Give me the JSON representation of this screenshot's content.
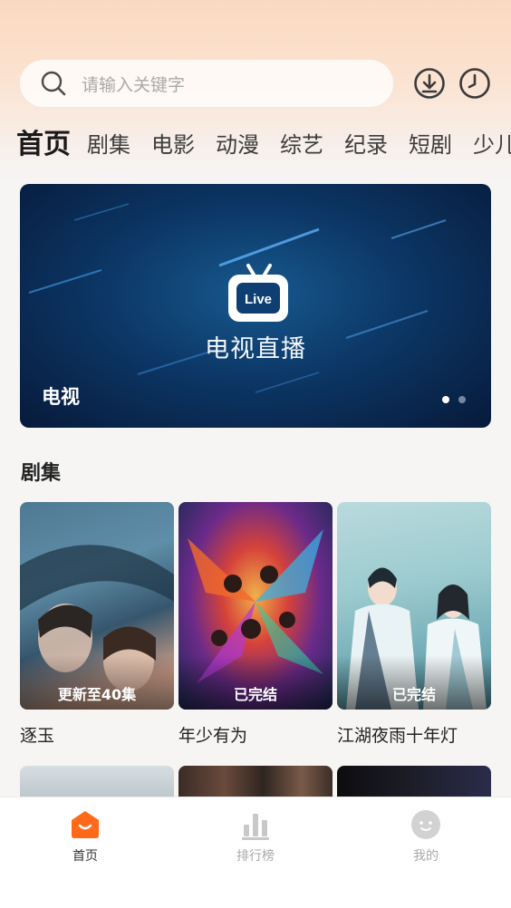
{
  "search": {
    "placeholder": "请输入关键字"
  },
  "header_icons": [
    "search-icon",
    "download-icon",
    "history-clock-icon"
  ],
  "tabs": [
    {
      "label": "首页",
      "active": true
    },
    {
      "label": "剧集"
    },
    {
      "label": "电影"
    },
    {
      "label": "动漫"
    },
    {
      "label": "综艺"
    },
    {
      "label": "纪录"
    },
    {
      "label": "短剧"
    },
    {
      "label": "少儿"
    }
  ],
  "banner": {
    "center_title": "电视直播",
    "tv_badge": "Live",
    "caption": "电视",
    "page_count": 2,
    "active_page": 1
  },
  "section": {
    "title": "剧集",
    "items": [
      {
        "title": "逐玉",
        "badge": "更新至40集"
      },
      {
        "title": "年少有为",
        "badge": "已完结"
      },
      {
        "title": "江湖夜雨十年灯",
        "badge": "已完结"
      }
    ]
  },
  "bottom_nav": [
    {
      "label": "首页",
      "icon": "home-icon",
      "active": true
    },
    {
      "label": "排行榜",
      "icon": "ranking-icon"
    },
    {
      "label": "我的",
      "icon": "profile-icon"
    }
  ],
  "colors": {
    "accent": "#ff6a1a",
    "inactive": "#c8c8c8",
    "banner_dark": "#071a3a",
    "banner_light": "#17598f"
  }
}
